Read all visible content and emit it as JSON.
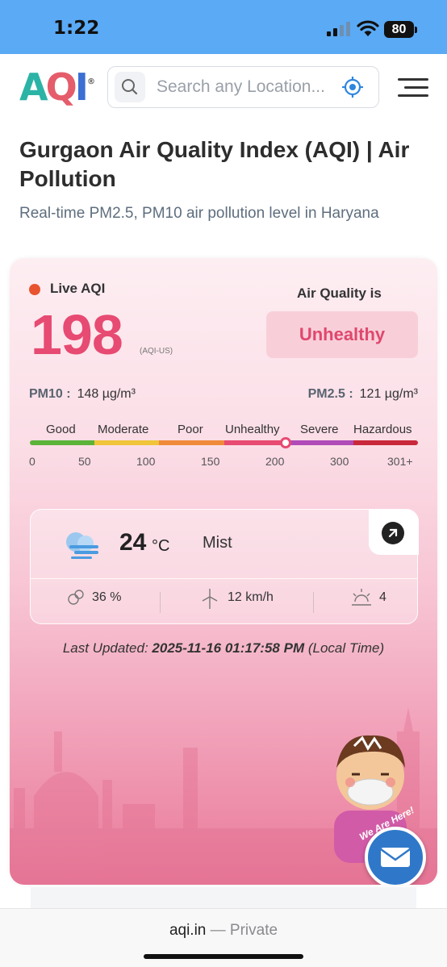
{
  "status_bar": {
    "time": "1:22",
    "battery": "80"
  },
  "header": {
    "logo_text": "AQI",
    "search_placeholder": "Search any Location..."
  },
  "page": {
    "title": "Gurgaon Air Quality Index (AQI) | Air Pollution",
    "subtitle": "Real-time PM2.5, PM10 air pollution level in Haryana"
  },
  "aqi": {
    "live_label": "Live AQI",
    "value": "198",
    "unit": "(AQI-US)",
    "quality_label": "Air Quality is",
    "status": "Unhealthy",
    "status_color": "#e0476d",
    "pm10_label": "PM10 :",
    "pm10_value": "148 µg/m³",
    "pm25_label": "PM2.5 :",
    "pm25_value": "121 µg/m³",
    "scale": {
      "labels": [
        "Good",
        "Moderate",
        "Poor",
        "Unhealthy",
        "Severe",
        "Hazardous"
      ],
      "colors": [
        "#5cb33a",
        "#f0c43b",
        "#f08a3b",
        "#e74a72",
        "#b04ab8",
        "#c9283c"
      ],
      "numbers": [
        "0",
        "50",
        "100",
        "150",
        "200",
        "300",
        "301+"
      ]
    }
  },
  "weather": {
    "temperature": "24",
    "temp_unit": "°C",
    "condition": "Mist",
    "humidity": "36 %",
    "wind": "12 km/h",
    "uv": "4"
  },
  "last_updated": {
    "prefix": "Last Updated:",
    "datetime": "2025-11-16 01:17:58 PM",
    "suffix": "(Local Time)"
  },
  "mascot_text": "We Are Here!",
  "browser": {
    "domain": "aqi.in",
    "separator": " — ",
    "mode": "Private"
  }
}
